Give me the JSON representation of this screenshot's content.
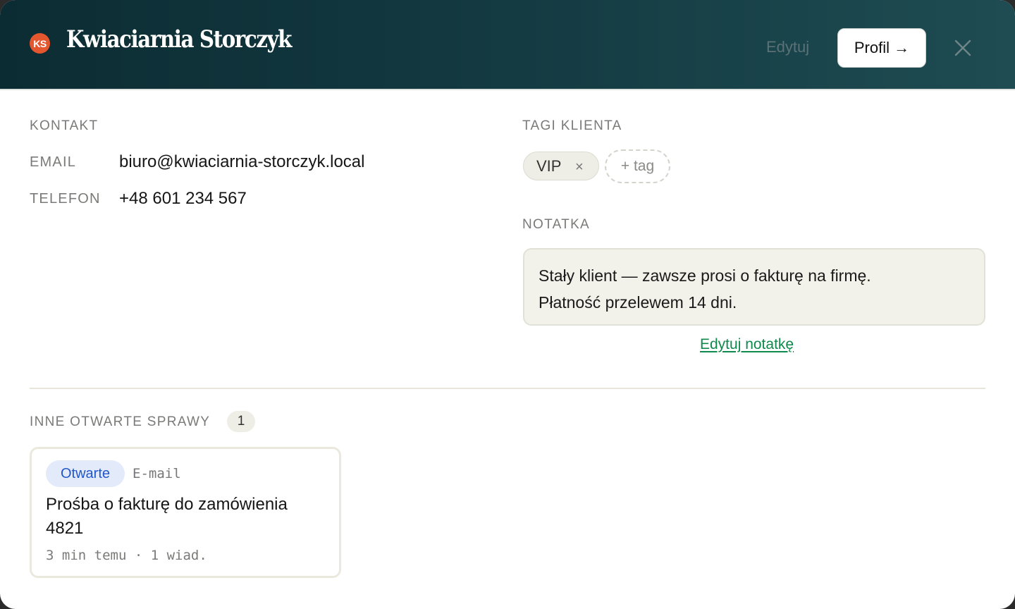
{
  "header": {
    "avatar_initials": "KS",
    "title": "Kwiaciarnia Storczyk",
    "edit_label": "Edytuj",
    "profile_label": "Profil →",
    "close_icon": "close-icon"
  },
  "contact": {
    "section_label": "KONTAKT",
    "email_label": "EMAIL",
    "email_value": "biuro@kwiaciarnia-storczyk.local",
    "phone_label": "TELEFON",
    "phone_value": "+48 601 234 567"
  },
  "tags": {
    "section_label": "TAGI KLIENTA",
    "items": [
      {
        "label": "VIP",
        "remove": "×"
      }
    ],
    "add_label": "+ tag"
  },
  "note": {
    "section_label": "NOTATKA",
    "lines": [
      "Stały klient — zawsze prosi o fakturę na firmę.",
      "Płatność przelewem 14 dni."
    ],
    "edit_label": "Edytuj notatkę"
  },
  "open_cases": {
    "section_label": "INNE OTWARTE SPRAWY",
    "count": "1",
    "items": [
      {
        "status": "Otwarte",
        "channel": "E-mail",
        "title": "Prośba o fakturę do zamówienia 4821",
        "meta": "3 min temu · 1 wiad."
      }
    ]
  },
  "colors": {
    "header_start": "#0c2c33",
    "header_end": "#1e4c52",
    "avatar": "#e4572e",
    "link_green": "#0f8a4c",
    "status_blue": "#2256c9"
  }
}
